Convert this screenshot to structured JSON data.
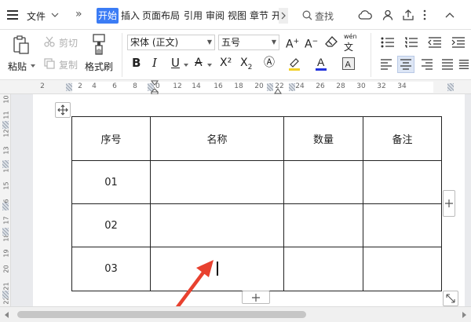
{
  "titlebar": {
    "file_menu": "文件",
    "more_tabs": "»",
    "tabs": [
      "开始",
      "插入",
      "页面布局",
      "引用",
      "审阅",
      "视图",
      "章节",
      "开"
    ],
    "search_label": "查找"
  },
  "ribbon": {
    "paste_label": "粘贴",
    "cut_label": "剪切",
    "copy_label": "复制",
    "format_painter_label": "格式刷",
    "font_name": "宋体 (正文)",
    "font_size": "五号",
    "bold": "B",
    "italic": "I",
    "underline": "U",
    "superscript": "X²"
  },
  "ruler": {
    "labels": [
      "2",
      "2",
      "4",
      "6",
      "8",
      "10",
      "12",
      "14",
      "16",
      "18",
      "20",
      "22",
      "24",
      "26",
      "28",
      "30",
      "32",
      "34"
    ]
  },
  "vertical_ruler": {
    "labels": [
      "10",
      "11",
      "12",
      "13",
      "14",
      "15",
      "16",
      "17",
      "18",
      "19",
      "20",
      "21",
      "22"
    ]
  },
  "table": {
    "headers": [
      "序号",
      "名称",
      "数量",
      "备注"
    ],
    "rows": [
      [
        "01",
        "",
        "",
        ""
      ],
      [
        "02",
        "",
        "",
        ""
      ],
      [
        "03",
        "",
        "",
        ""
      ]
    ]
  },
  "colors": {
    "active_tab": "#3b7cf5",
    "annotation_arrow": "#e8412f",
    "font_color_underline": "#2233dd",
    "highlight_underline": "#f2d026"
  },
  "icons": [
    "chevron-down-icon",
    "search-icon",
    "cloud-sync-icon",
    "user-icon",
    "share-icon",
    "more-icon",
    "paste-icon",
    "scissors-icon",
    "copy-icon",
    "paintbrush-icon",
    "move-table-icon",
    "add-row-icon",
    "add-column-icon",
    "resize-table-icon",
    "cursor-arrow-icon"
  ]
}
